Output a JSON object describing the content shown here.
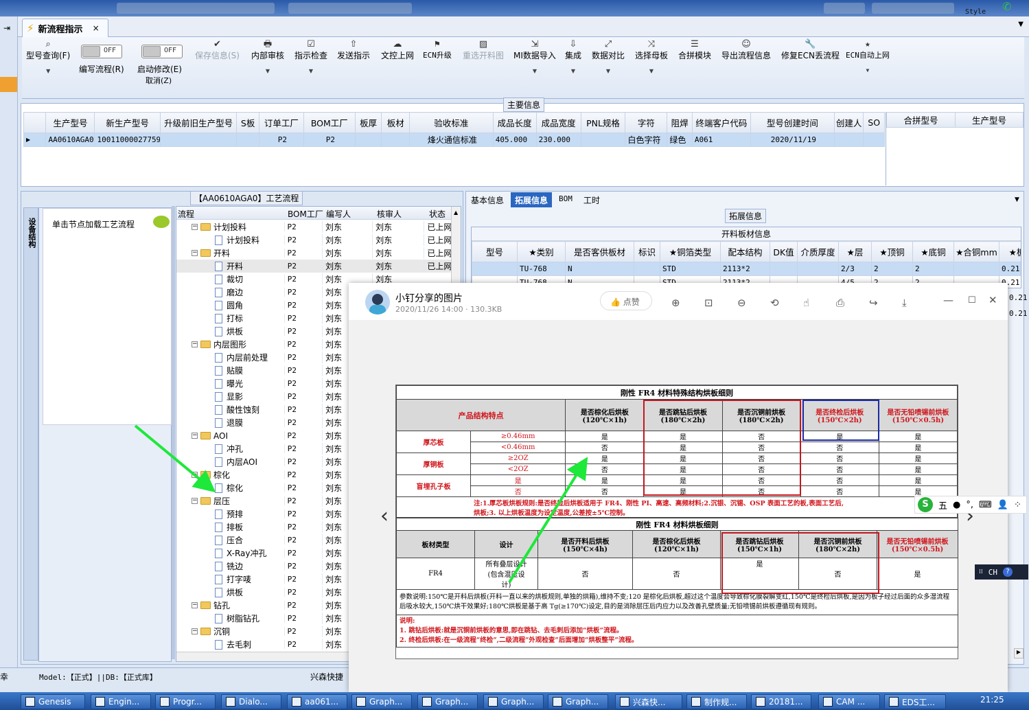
{
  "ribbon": {
    "doc_tab": "新流程指示",
    "items": [
      {
        "label": "型号查询(F)",
        "icon": "search-icon"
      },
      {
        "label": "编写流程(R)",
        "toggle": "OFF"
      },
      {
        "label": "启动修改(E)",
        "label2": "取消(Z)",
        "toggle": "OFF"
      },
      {
        "label": "保存信息(S)",
        "icon": "check-icon",
        "disabled": true
      },
      {
        "label": "内部审核",
        "icon": "printer-icon"
      },
      {
        "label": "指示检查",
        "icon": "checkbox-icon"
      },
      {
        "label": "发送指示",
        "icon": "upload-icon"
      },
      {
        "label": "文控上网",
        "icon": "cloud-upload-icon"
      },
      {
        "label": "ECN升级",
        "icon": "ecn-icon"
      },
      {
        "label": "重选开料图",
        "icon": "image-icon",
        "disabled": true
      },
      {
        "label": "MI数据导入",
        "icon": "import-icon"
      },
      {
        "label": "集成",
        "icon": "download-icon"
      },
      {
        "label": "数据对比",
        "icon": "compare-icon"
      },
      {
        "label": "选择母板",
        "icon": "shuffle-icon"
      },
      {
        "label": "合拼模块",
        "icon": "list-icon"
      },
      {
        "label": "导出流程信息",
        "icon": "smile-icon"
      },
      {
        "label": "修复ECN丢流程",
        "icon": "wrench-icon"
      },
      {
        "label": "ECN自动上网",
        "icon": "star-icon"
      }
    ]
  },
  "main_info": {
    "title": "主要信息",
    "columns": [
      "生产型号",
      "新生产型号",
      "升级前旧生产型号",
      "S板",
      "订单工厂",
      "BOM工厂",
      "板厚",
      "板材",
      "验收标准",
      "成品长度",
      "成品宽度",
      "PNL规格",
      "字符",
      "阻焊",
      "终端客户代码",
      "型号创建时间",
      "创建人",
      "SO"
    ],
    "row": [
      "AA0610AGA0",
      "10011000027759",
      "",
      "",
      "P2",
      "P2",
      "",
      "",
      "烽火通信标准",
      "405.000",
      "230.000",
      "",
      "白色字符",
      "绿色",
      "A061",
      "2020/11/19",
      "",
      ""
    ],
    "merge_columns": [
      "合拼型号",
      "生产型号"
    ]
  },
  "process": {
    "title": "【AA0610AGA0】工艺流程",
    "side_tab": "设备结构",
    "hint": "单击节点加载工艺流程",
    "columns": [
      "流程",
      "BOM工厂",
      "编写人",
      "核审人",
      "状态"
    ],
    "rows": [
      {
        "name": "计划投料",
        "level": 0,
        "folder": true,
        "f": "P2",
        "w": "刘东",
        "r": "刘东",
        "s": "已上网"
      },
      {
        "name": "计划投料",
        "level": 1,
        "f": "P2",
        "w": "刘东",
        "r": "刘东",
        "s": "已上网"
      },
      {
        "name": "开料",
        "level": 0,
        "folder": true,
        "f": "P2",
        "w": "刘东",
        "r": "刘东",
        "s": "已上网"
      },
      {
        "name": "开料",
        "level": 1,
        "f": "P2",
        "w": "刘东",
        "r": "刘东",
        "s": "已上网"
      },
      {
        "name": "裁切",
        "level": 1,
        "f": "P2",
        "w": "刘东",
        "r": "刘东",
        "s": ""
      },
      {
        "name": "磨边",
        "level": 1,
        "f": "P2",
        "w": "刘东",
        "r": "",
        "s": ""
      },
      {
        "name": "圆角",
        "level": 1,
        "f": "P2",
        "w": "刘东",
        "r": "",
        "s": ""
      },
      {
        "name": "打标",
        "level": 1,
        "f": "P2",
        "w": "刘东",
        "r": "",
        "s": ""
      },
      {
        "name": "烘板",
        "level": 1,
        "f": "P2",
        "w": "刘东",
        "r": "",
        "s": ""
      },
      {
        "name": "内层图形",
        "level": 0,
        "folder": true,
        "f": "P2",
        "w": "刘东",
        "r": "",
        "s": ""
      },
      {
        "name": "内层前处理",
        "level": 1,
        "f": "P2",
        "w": "刘东",
        "r": "",
        "s": ""
      },
      {
        "name": "贴膜",
        "level": 1,
        "f": "P2",
        "w": "刘东",
        "r": "",
        "s": ""
      },
      {
        "name": "曝光",
        "level": 1,
        "f": "P2",
        "w": "刘东",
        "r": "",
        "s": ""
      },
      {
        "name": "显影",
        "level": 1,
        "f": "P2",
        "w": "刘东",
        "r": "",
        "s": ""
      },
      {
        "name": "酸性蚀刻",
        "level": 1,
        "f": "P2",
        "w": "刘东",
        "r": "",
        "s": ""
      },
      {
        "name": "退膜",
        "level": 1,
        "f": "P2",
        "w": "刘东",
        "r": "",
        "s": ""
      },
      {
        "name": "AOI",
        "level": 0,
        "folder": true,
        "f": "P2",
        "w": "刘东",
        "r": "",
        "s": ""
      },
      {
        "name": "冲孔",
        "level": 1,
        "f": "P2",
        "w": "刘东",
        "r": "",
        "s": ""
      },
      {
        "name": "内层AOI",
        "level": 1,
        "f": "P2",
        "w": "刘东",
        "r": "",
        "s": ""
      },
      {
        "name": "棕化",
        "level": 0,
        "folder": true,
        "f": "P2",
        "w": "刘东",
        "r": "",
        "s": ""
      },
      {
        "name": "棕化",
        "level": 1,
        "f": "P2",
        "w": "刘东",
        "r": "",
        "s": ""
      },
      {
        "name": "层压",
        "level": 0,
        "folder": true,
        "f": "P2",
        "w": "刘东",
        "r": "",
        "s": ""
      },
      {
        "name": "预排",
        "level": 1,
        "f": "P2",
        "w": "刘东",
        "r": "",
        "s": ""
      },
      {
        "name": "排板",
        "level": 1,
        "f": "P2",
        "w": "刘东",
        "r": "",
        "s": ""
      },
      {
        "name": "压合",
        "level": 1,
        "f": "P2",
        "w": "刘东",
        "r": "",
        "s": ""
      },
      {
        "name": "X-Ray冲孔",
        "level": 1,
        "f": "P2",
        "w": "刘东",
        "r": "",
        "s": ""
      },
      {
        "name": "铣边",
        "level": 1,
        "f": "P2",
        "w": "刘东",
        "r": "",
        "s": ""
      },
      {
        "name": "打字唛",
        "level": 1,
        "f": "P2",
        "w": "刘东",
        "r": "",
        "s": ""
      },
      {
        "name": "烘板",
        "level": 1,
        "f": "P2",
        "w": "刘东",
        "r": "",
        "s": ""
      },
      {
        "name": "钻孔",
        "level": 0,
        "folder": true,
        "f": "P2",
        "w": "刘东",
        "r": "",
        "s": ""
      },
      {
        "name": "树脂钻孔",
        "level": 1,
        "f": "P2",
        "w": "刘东",
        "r": "",
        "s": ""
      },
      {
        "name": "沉铜",
        "level": 0,
        "folder": true,
        "f": "P2",
        "w": "刘东",
        "r": "",
        "s": ""
      },
      {
        "name": "去毛刺",
        "level": 1,
        "f": "P2",
        "w": "刘东",
        "r": "",
        "s": ""
      }
    ]
  },
  "right_panel": {
    "tabs": [
      "基本信息",
      "拓展信息",
      "BOM",
      "工时"
    ],
    "active_tab": "拓展信息",
    "group": "拓展信息",
    "table_title": "开料板材信息",
    "columns": [
      "型号",
      "★类别",
      "是否客供板材",
      "标识",
      "★铜箔类型",
      "配本结构",
      "DK值",
      "介质厚度",
      "★层",
      "★顶铜",
      "★底铜",
      "★合铜mm",
      "★板"
    ],
    "rows": [
      [
        "",
        "TU-768",
        "N",
        "",
        "STD",
        "2113*2",
        "",
        "",
        "2/3",
        "2",
        "2",
        "",
        "0.21"
      ],
      [
        "",
        "TU-768",
        "N",
        "",
        "STD",
        "2113*2",
        "",
        "",
        "4/5",
        "2",
        "2",
        "",
        "0.21"
      ]
    ],
    "extra_vals": [
      "0.21",
      "0.21"
    ]
  },
  "viewer": {
    "title": "小钉分享的图片",
    "meta": "2020/11/26 14:00 · 130.3KB",
    "like": "点赞",
    "doc": {
      "t1": "刚性 FR4 材料特殊结构烘板细则",
      "struct_label": "产品结构特点",
      "h1": [
        "是否棕化后烘板",
        "(120℃×1h)"
      ],
      "h2": [
        "是否跳钻后烘板",
        "(180℃×2h)"
      ],
      "h3": [
        "是否沉铜前烘板",
        "(180℃×2h)"
      ],
      "h4": [
        "是否终检后烘板",
        "(150℃×2h)"
      ],
      "h5": [
        "是否无铅喷锡前烘板",
        "(150℃×0.5h)"
      ],
      "groups": [
        "厚芯板",
        "厚铜板",
        "盲埋孔子板"
      ],
      "conds": [
        "≥0.46mm",
        "<0.46mm",
        "≥2OZ",
        "<2OZ",
        "是",
        "否"
      ],
      "matrix": [
        [
          "是",
          "是",
          "否",
          "是",
          "是"
        ],
        [
          "否",
          "是",
          "否",
          "否",
          "是"
        ],
        [
          "是",
          "是",
          "否",
          "否",
          "是"
        ],
        [
          "否",
          "是",
          "否",
          "否",
          "是"
        ],
        [
          "是",
          "是",
          "否",
          "否",
          "是"
        ],
        [
          "否",
          "是",
          "否",
          "否",
          "是"
        ]
      ],
      "note1": "注:1.厚芯板烘板规则:是否终检后烘板适用于 FR4、刚性 PI、高速、高频材料;2.沉银、沉锡、OSP 表面工艺的板,表面工艺后,",
      "note2": "烘板;3. 以上烘板温度为设定温度,公差按±5℃控制。",
      "t2": "刚性 FR4 材料烘板细则",
      "c2": [
        "板材类型",
        "设计",
        "是否开料后烘板(150℃×4h)",
        "是否棕化后烘板(120℃×1h)"
      ],
      "c2b": [
        "是否跳钻后烘板",
        "(150℃×1h)"
      ],
      "c2c": [
        "是否沉铜前烘板",
        "(180℃×2h)"
      ],
      "c2d": [
        "是否无铅喷锡前烘板",
        "(150℃×0.5h)"
      ],
      "r2": [
        "FR4",
        "所有叠层设计",
        "(包含混压设",
        "计)",
        "否",
        "否",
        "是",
        "否",
        "是"
      ],
      "param": "参数说明:150℃是开料后烘板(开料一直以来的烘板规则,单独的烘箱),维持不变;120 是棕化后烘板,超过这个温度会导致棕化膜裂解变红,150℃是终检后烘板,是因为板子经过后面的众多湿流程后吸水较大,150℃烘干效果好;180℃烘板是基于高 Tg(≥170℃)设定,目的是消除层压后内应力以及改善孔壁质量;无铅喷锡前烘板遵循现有规则。",
      "expl_title": "说明:",
      "expl1": "1. 跳钻后烘板:就是沉铜前烘板的意思,即在跳钻、去毛刺后添加“烘板”流程。",
      "expl2": "2. 终检后烘板:在一级流程“终检”,二级流程“外观检查”后面增加“烘板整平”流程。"
    }
  },
  "ime": {
    "label": "五",
    "lang": "CH"
  },
  "status": {
    "model": "Model:【正式】||DB:【正式库】",
    "company": "兴森快捷",
    "left": "幸"
  },
  "style_label": "Style",
  "taskbar": {
    "items": [
      "Genesis",
      "Engin...",
      "Progr...",
      "Dialo...",
      "aa061...",
      "Graph...",
      "Graph...",
      "Graph...",
      "Graph...",
      "兴森快...",
      "制作规...",
      "20181...",
      "CAM ...",
      "EDS工..."
    ],
    "clock": "21:25"
  },
  "colors": {
    "accent": "#2b62b3",
    "red_box": "#c0181e",
    "blue_box": "#1c2aa8",
    "arrow": "#1ee83a"
  }
}
